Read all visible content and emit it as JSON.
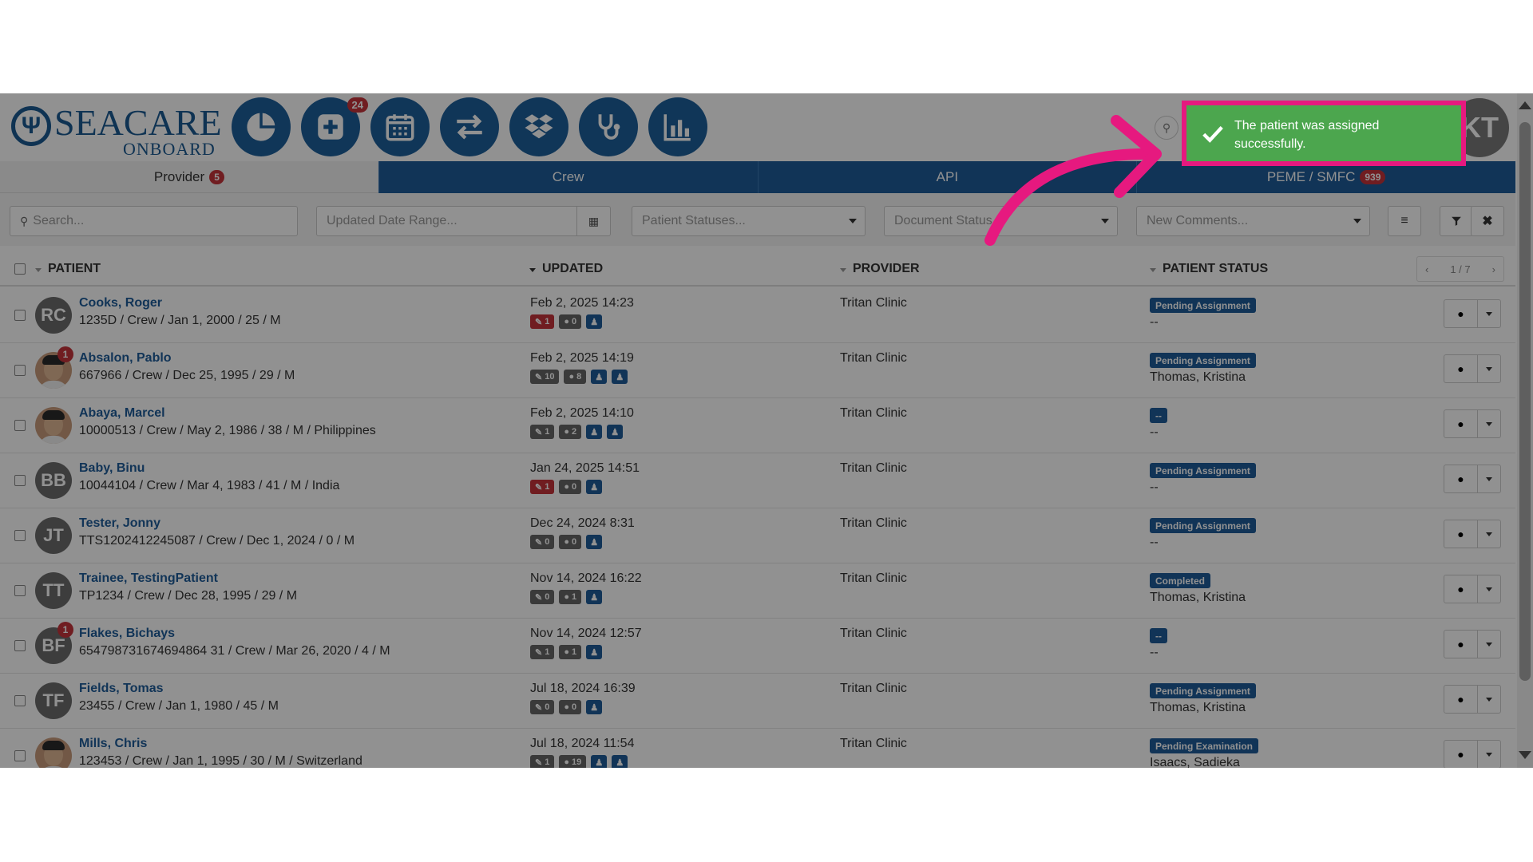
{
  "header": {
    "logo_brand": "SEACARE",
    "logo_sub": "ONBOARD",
    "logo_symbol": "Ψ",
    "nav_buttons": [
      {
        "icon": "pie-chart-icon",
        "badge": ""
      },
      {
        "icon": "plus-square-icon",
        "badge": "24"
      },
      {
        "icon": "calendar-icon",
        "badge": ""
      },
      {
        "icon": "exchange-icon",
        "badge": ""
      },
      {
        "icon": "dropbox-icon",
        "badge": ""
      },
      {
        "icon": "stethoscope-icon",
        "badge": ""
      },
      {
        "icon": "bar-chart-icon",
        "badge": ""
      }
    ],
    "user_initials": "KT"
  },
  "tabs": [
    {
      "label": "Provider",
      "count": "5",
      "active": true
    },
    {
      "label": "Crew",
      "count": "",
      "active": false
    },
    {
      "label": "API",
      "count": "",
      "active": false
    },
    {
      "label": "PEME / SMFC",
      "count": "939",
      "active": false
    }
  ],
  "filters": {
    "search_placeholder": "Search...",
    "date_range_placeholder": "Updated Date Range...",
    "patient_statuses_placeholder": "Patient Statuses...",
    "document_status_placeholder": "Document Status...",
    "new_comments_placeholder": "New Comments..."
  },
  "table": {
    "columns": {
      "patient": "PATIENT",
      "updated": "UPDATED",
      "provider": "PROVIDER",
      "patient_status": "PATIENT STATUS"
    },
    "pager": "1 / 7",
    "rows": [
      {
        "initials": "RC",
        "photo": false,
        "badge": "",
        "name": "Cooks, Roger",
        "info": "1235D / Crew / Jan 1, 2000 / 25 / M",
        "updated": "Feb 2, 2025 14:23",
        "docs": "1",
        "docs_red": true,
        "comments": "0",
        "people": 1,
        "provider": "Tritan Clinic",
        "status": "Pending Assignment",
        "assignee": "--"
      },
      {
        "initials": "",
        "photo": true,
        "badge": "1",
        "name": "Absalon, Pablo",
        "info": "667966 / Crew / Dec 25, 1995 / 29 / M",
        "updated": "Feb 2, 2025 14:19",
        "docs": "10",
        "docs_red": false,
        "comments": "8",
        "people": 2,
        "provider": "Tritan Clinic",
        "status": "Pending Assignment",
        "assignee": "Thomas, Kristina"
      },
      {
        "initials": "",
        "photo": true,
        "badge": "",
        "name": "Abaya, Marcel",
        "info": "10000513 / Crew / May 2, 1986 / 38 / M / Philippines",
        "updated": "Feb 2, 2025 14:10",
        "docs": "1",
        "docs_red": false,
        "comments": "2",
        "people": 2,
        "provider": "Tritan Clinic",
        "status": "--",
        "assignee": "--"
      },
      {
        "initials": "BB",
        "photo": false,
        "badge": "",
        "name": "Baby, Binu",
        "info": "10044104 / Crew / Mar 4, 1983 / 41 / M / India",
        "updated": "Jan 24, 2025 14:51",
        "docs": "1",
        "docs_red": true,
        "comments": "0",
        "people": 1,
        "provider": "Tritan Clinic",
        "status": "Pending Assignment",
        "assignee": "--"
      },
      {
        "initials": "JT",
        "photo": false,
        "badge": "",
        "name": "Tester, Jonny",
        "info": "TTS1202412245087 / Crew / Dec 1, 2024 / 0 / M",
        "updated": "Dec 24, 2024 8:31",
        "docs": "0",
        "docs_red": false,
        "comments": "0",
        "people": 1,
        "provider": "Tritan Clinic",
        "status": "Pending Assignment",
        "assignee": "--"
      },
      {
        "initials": "TT",
        "photo": false,
        "badge": "",
        "name": "Trainee, TestingPatient",
        "info": "TP1234 / Crew / Dec 28, 1995 / 29 / M",
        "updated": "Nov 14, 2024 16:22",
        "docs": "0",
        "docs_red": false,
        "comments": "1",
        "people": 1,
        "provider": "Tritan Clinic",
        "status": "Completed",
        "assignee": "Thomas, Kristina"
      },
      {
        "initials": "BF",
        "photo": false,
        "badge": "1",
        "name": "Flakes, Bichays",
        "info": "654798731674694864 31 / Crew / Mar 26, 2020 / 4 / M",
        "updated": "Nov 14, 2024 12:57",
        "docs": "1",
        "docs_red": false,
        "comments": "1",
        "people": 1,
        "provider": "Tritan Clinic",
        "status": "--",
        "assignee": "--"
      },
      {
        "initials": "TF",
        "photo": false,
        "badge": "",
        "name": "Fields, Tomas",
        "info": "23455 / Crew / Jan 1, 1980 / 45 / M",
        "updated": "Jul 18, 2024 16:39",
        "docs": "0",
        "docs_red": false,
        "comments": "0",
        "people": 1,
        "provider": "Tritan Clinic",
        "status": "Pending Assignment",
        "assignee": "Thomas, Kristina"
      },
      {
        "initials": "",
        "photo": true,
        "badge": "",
        "name": "Mills, Chris",
        "info": "123453 / Crew / Jan 1, 1995 / 30 / M / Switzerland",
        "updated": "Jul 18, 2024 11:54",
        "docs": "1",
        "docs_red": false,
        "comments": "19",
        "people": 2,
        "provider": "Tritan Clinic",
        "status": "Pending Examination",
        "assignee": "Isaacs, Sadieka"
      }
    ]
  },
  "toast": {
    "message": "The patient was assigned successfully.",
    "color": "#4ca64e",
    "highlight_color": "#e6197f"
  }
}
